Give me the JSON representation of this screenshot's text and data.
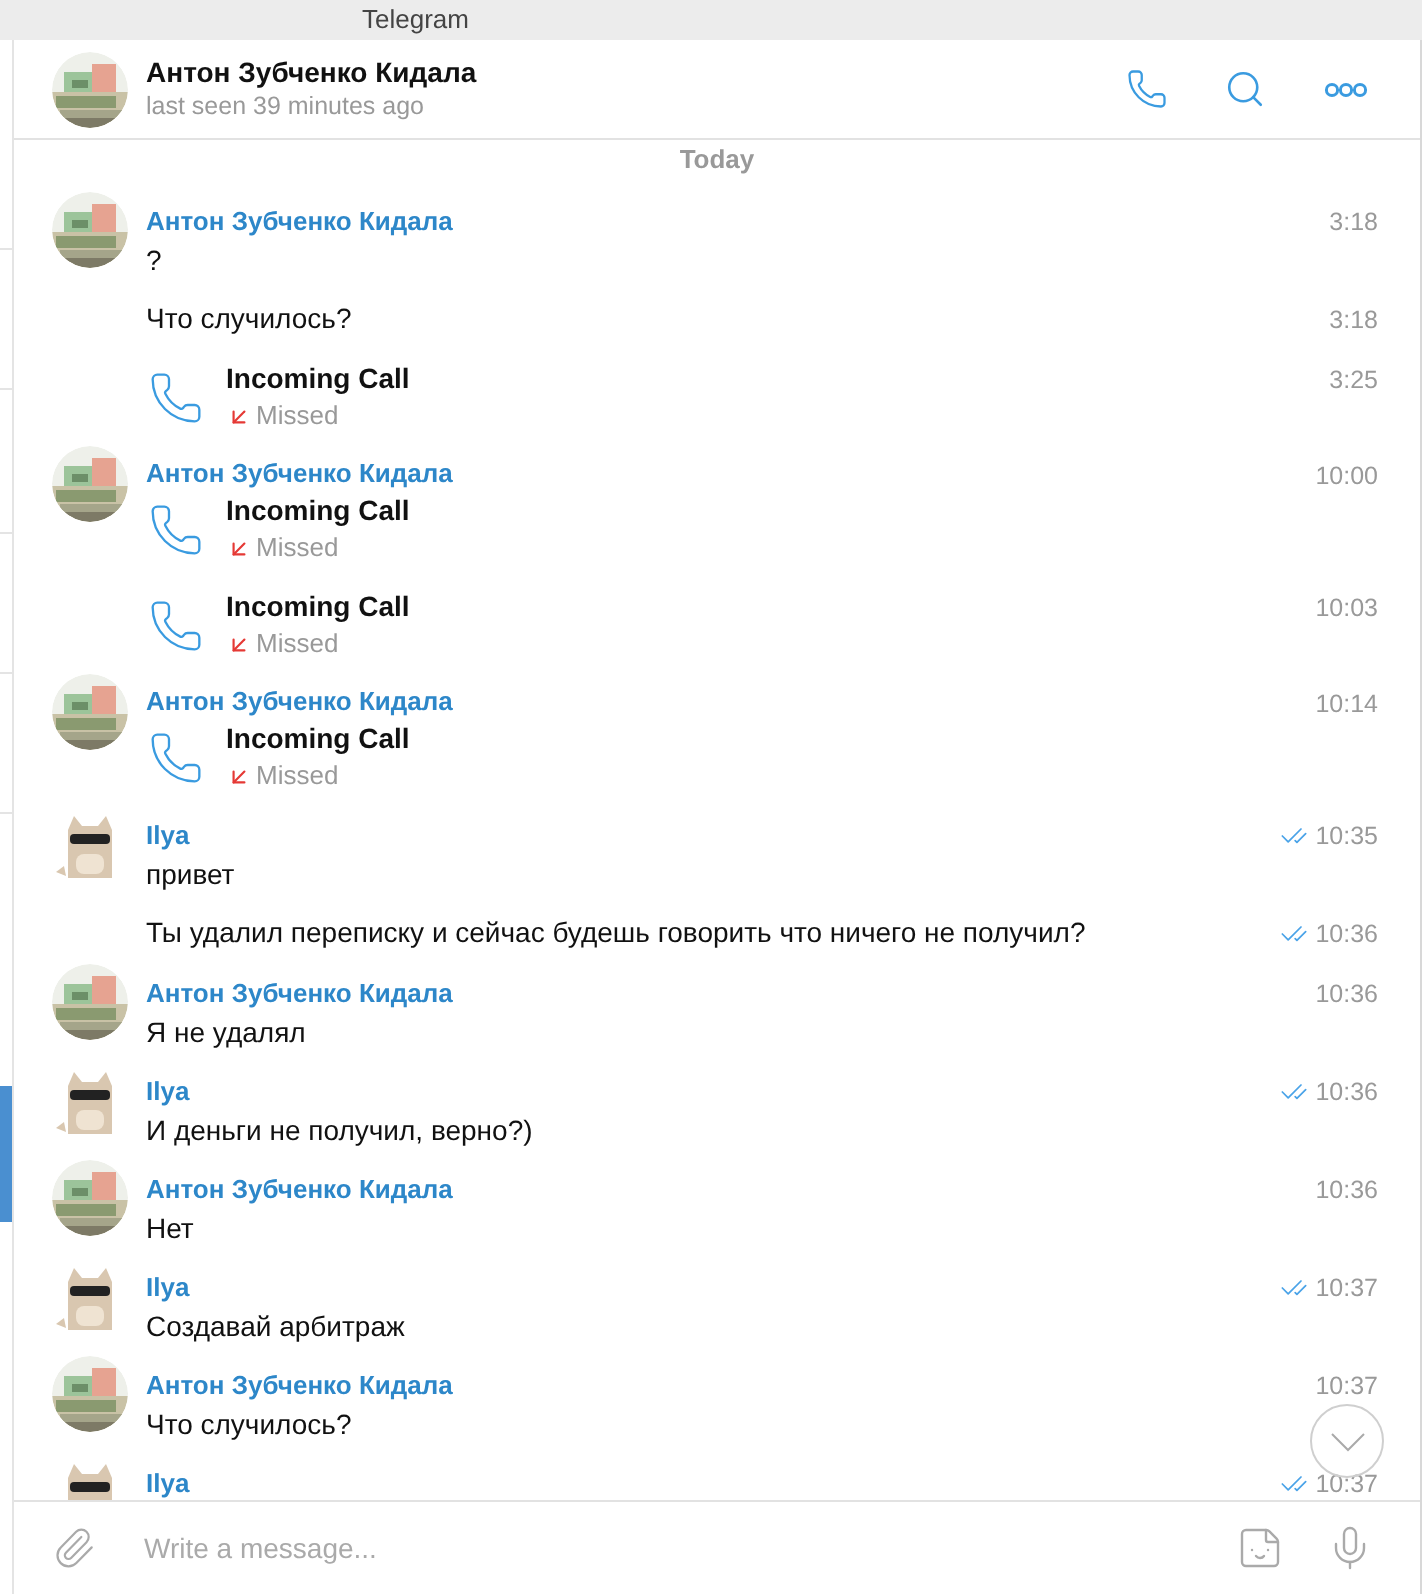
{
  "window": {
    "title": "Telegram"
  },
  "chat_header": {
    "name": "Антон Зубченко Кидала",
    "status": "last seen 39 minutes ago"
  },
  "date_separator": "Today",
  "messages": [
    {
      "kind": "text",
      "author": {
        "name": "Антон Зубченко Кидала",
        "kind": "picture"
      },
      "text": "?",
      "time": "3:18",
      "read": false
    },
    {
      "kind": "text",
      "text": "Что случилось?",
      "time": "3:18",
      "read": false
    },
    {
      "kind": "call",
      "title": "Incoming Call",
      "status": "Missed",
      "missed": true,
      "time": "3:25",
      "read": false
    },
    {
      "kind": "call",
      "author": {
        "name": "Антон Зубченко Кидала",
        "kind": "picture"
      },
      "title": "Incoming Call",
      "status": "Missed",
      "missed": true,
      "time": "10:00",
      "read": false
    },
    {
      "kind": "call",
      "title": "Incoming Call",
      "status": "Missed",
      "missed": true,
      "time": "10:03",
      "read": false
    },
    {
      "kind": "call",
      "author": {
        "name": "Антон Зубченко Кидала",
        "kind": "picture"
      },
      "title": "Incoming Call",
      "status": "Missed",
      "missed": true,
      "time": "10:14",
      "read": false
    },
    {
      "kind": "text",
      "author": {
        "name": "Ilya",
        "kind": "sticker"
      },
      "text": "привет",
      "time": "10:35",
      "read": true
    },
    {
      "kind": "text",
      "text": "Ты удалил переписку и сейчас будешь говорить что ничего не получил?",
      "time": "10:36",
      "read": true
    },
    {
      "kind": "text",
      "author": {
        "name": "Антон Зубченко Кидала",
        "kind": "picture"
      },
      "text": "Я не удалял",
      "time": "10:36",
      "read": false
    },
    {
      "kind": "text",
      "author": {
        "name": "Ilya",
        "kind": "sticker"
      },
      "text": "И деньги не получил, верно?)",
      "time": "10:36",
      "read": true
    },
    {
      "kind": "text",
      "author": {
        "name": "Антон Зубченко Кидала",
        "kind": "picture"
      },
      "text": "Нет",
      "time": "10:36",
      "read": false
    },
    {
      "kind": "text",
      "author": {
        "name": "Ilya",
        "kind": "sticker"
      },
      "text": "Создавай арбитраж",
      "time": "10:37",
      "read": true
    },
    {
      "kind": "text",
      "author": {
        "name": "Антон Зубченко Кидала",
        "kind": "picture"
      },
      "text": "Что случилось?",
      "time": "10:37",
      "read": false
    },
    {
      "kind": "text",
      "author": {
        "name": "Ilya",
        "kind": "sticker"
      },
      "time": "10:37",
      "read": true
    }
  ],
  "composer": {
    "placeholder": "Write a message..."
  }
}
